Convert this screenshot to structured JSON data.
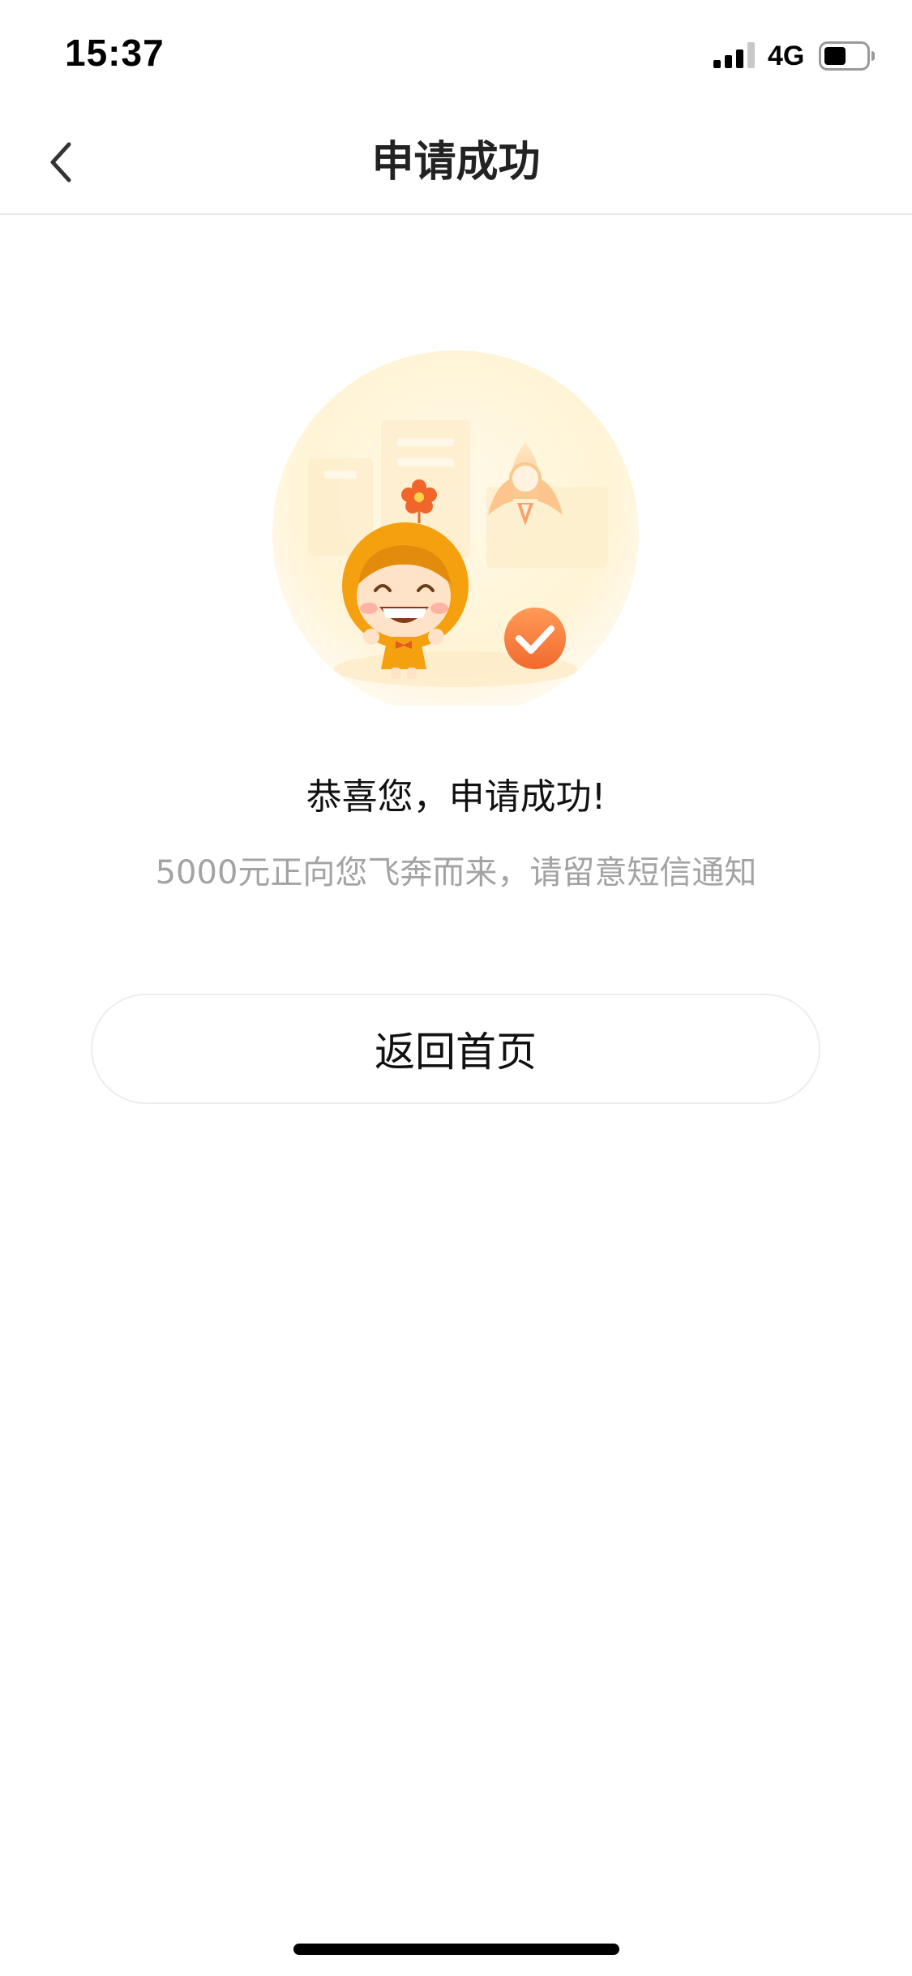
{
  "status_bar": {
    "time": "15:37",
    "network": "4G",
    "icons": [
      "signal-icon",
      "battery-icon"
    ]
  },
  "nav": {
    "title": "申请成功",
    "back_icon": "chevron-left-icon"
  },
  "illustration": {
    "description_icon": "success-illustration",
    "accent_color": "#f5a623",
    "check_color": "#f26a2e"
  },
  "message": {
    "title": "恭喜您，申请成功!",
    "subtitle": "5000元正向您飞奔而来，请留意短信通知"
  },
  "actions": {
    "home_label": "返回首页"
  }
}
